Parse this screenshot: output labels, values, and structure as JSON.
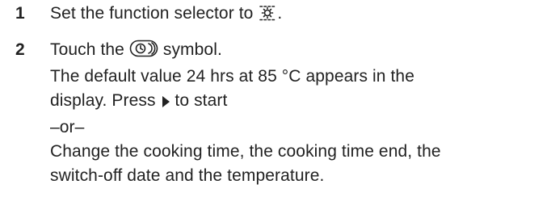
{
  "steps": [
    {
      "number": "1",
      "text_before_icon": "Set the function selector to ",
      "icon": "top-bottom-heat-icon",
      "text_after_icon": "."
    },
    {
      "number": "2",
      "line1_before_icon": "Touch the ",
      "icon": "clock-timer-icon",
      "line1_after_icon": " symbol.",
      "line2": "The default value 24 hrs at 85 °C appears in the",
      "line3_before_icon": "display. Press ",
      "start_icon": "play-triangle-icon",
      "line3_after_icon": " to start",
      "line4": "–or–",
      "line5": "Change the cooking time, the cooking time end, the",
      "line6": "switch-off date and the temperature."
    }
  ]
}
